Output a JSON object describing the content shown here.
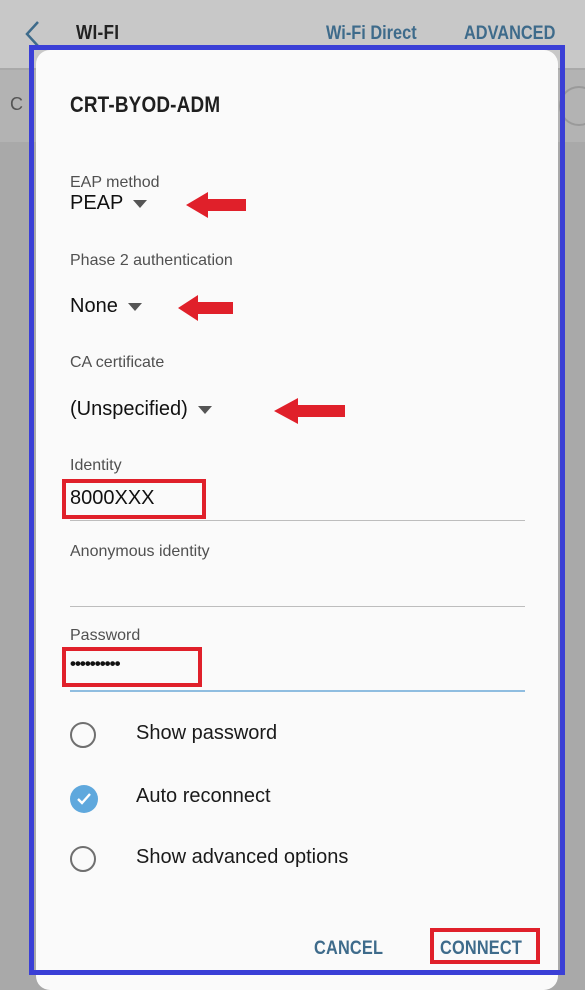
{
  "appbar": {
    "title": "WI-FI",
    "wifi_direct": "Wi-Fi Direct",
    "advanced": "ADVANCED",
    "bg_letter": "C"
  },
  "dialog": {
    "title": "CRT-BYOD-ADM",
    "eap_method": {
      "label": "EAP method",
      "value": "PEAP"
    },
    "phase2": {
      "label": "Phase 2 authentication",
      "value": "None"
    },
    "ca_cert": {
      "label": "CA certificate",
      "value": "(Unspecified)"
    },
    "identity": {
      "label": "Identity",
      "value": "8000XXX"
    },
    "anonymous": {
      "label": "Anonymous identity",
      "value": ""
    },
    "password": {
      "label": "Password",
      "value": "••••••••••"
    },
    "options": {
      "show_password": {
        "label": "Show password",
        "checked": false
      },
      "auto_reconnect": {
        "label": "Auto reconnect",
        "checked": true
      },
      "show_advanced": {
        "label": "Show advanced options",
        "checked": false
      }
    },
    "buttons": {
      "cancel": "CANCEL",
      "connect": "CONNECT"
    }
  },
  "colors": {
    "accent": "#3e6b8b",
    "highlight_red": "#e0202a",
    "frame_blue": "#3a3fd6",
    "check_blue": "#5fa8dd"
  },
  "icons": {
    "back": "chevron-left-icon",
    "dropdown": "caret-down-icon",
    "annotation_arrow": "red-arrow-left-icon",
    "checked": "check-icon"
  }
}
